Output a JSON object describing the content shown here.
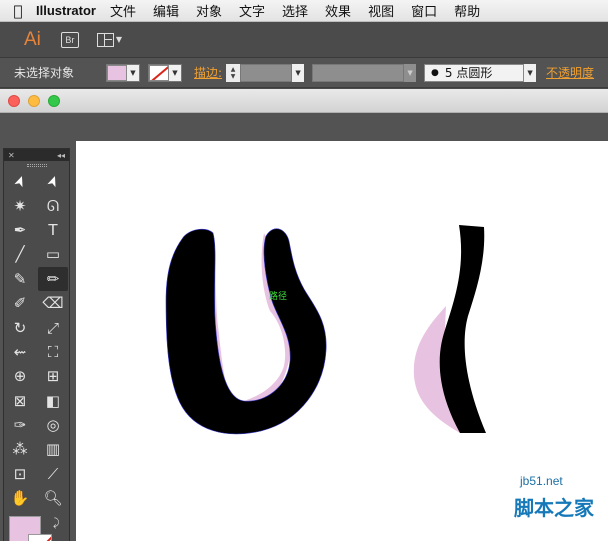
{
  "menubar": {
    "apple_icon": "apple-logo-icon",
    "app_name": "Illustrator",
    "items": [
      "文件",
      "编辑",
      "对象",
      "文字",
      "选择",
      "效果",
      "视图",
      "窗口",
      "帮助"
    ]
  },
  "appbar": {
    "logo": "Ai",
    "bridge_label": "Br"
  },
  "control": {
    "selection_label": "未选择对象",
    "stroke_label": "描边:",
    "brush_label": "5 点圆形",
    "opacity_label": "不透明度"
  },
  "canvas": {
    "path_label": "路径"
  },
  "colors": {
    "fill": "#e8c3e1",
    "stroke_none_slash": "#d9261c",
    "accent_orange": "#f0a030",
    "path_highlight": "#3ee03e"
  },
  "tools": [
    {
      "name": "selection-tool-icon",
      "glyph": "➤"
    },
    {
      "name": "direct-selection-tool-icon",
      "glyph": "➤"
    },
    {
      "name": "magic-wand-tool-icon",
      "glyph": "✷"
    },
    {
      "name": "lasso-tool-icon",
      "glyph": "ᘏ"
    },
    {
      "name": "pen-tool-icon",
      "glyph": "✒"
    },
    {
      "name": "type-tool-icon",
      "glyph": "T"
    },
    {
      "name": "line-segment-tool-icon",
      "glyph": "╱"
    },
    {
      "name": "rectangle-tool-icon",
      "glyph": "▭"
    },
    {
      "name": "paintbrush-tool-icon",
      "glyph": "✎"
    },
    {
      "name": "pencil-tool-icon",
      "glyph": "✏"
    },
    {
      "name": "blob-brush-tool-icon",
      "glyph": "✐"
    },
    {
      "name": "eraser-tool-icon",
      "glyph": "⌫"
    },
    {
      "name": "rotate-tool-icon",
      "glyph": "↻"
    },
    {
      "name": "scale-tool-icon",
      "glyph": "⤢"
    },
    {
      "name": "width-tool-icon",
      "glyph": "⇜"
    },
    {
      "name": "free-transform-tool-icon",
      "glyph": "⛶"
    },
    {
      "name": "shape-builder-tool-icon",
      "glyph": "⊕"
    },
    {
      "name": "perspective-grid-tool-icon",
      "glyph": "⊞"
    },
    {
      "name": "mesh-tool-icon",
      "glyph": "⊠"
    },
    {
      "name": "gradient-tool-icon",
      "glyph": "◧"
    },
    {
      "name": "eyedropper-tool-icon",
      "glyph": "✑"
    },
    {
      "name": "blend-tool-icon",
      "glyph": "◎"
    },
    {
      "name": "symbol-sprayer-tool-icon",
      "glyph": "⁂"
    },
    {
      "name": "column-graph-tool-icon",
      "glyph": "▥"
    },
    {
      "name": "artboard-tool-icon",
      "glyph": "⊡"
    },
    {
      "name": "slice-tool-icon",
      "glyph": "⟋"
    },
    {
      "name": "hand-tool-icon",
      "glyph": "✋"
    },
    {
      "name": "zoom-tool-icon",
      "glyph": "🔍︎"
    }
  ],
  "watermark": {
    "url": "jb51.net",
    "name": "脚本之家"
  }
}
